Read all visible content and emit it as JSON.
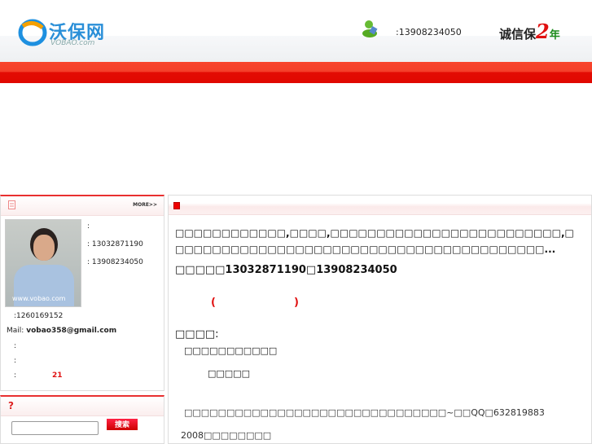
{
  "header": {
    "logo_cn": "沃保网",
    "logo_en": "VOBAO.com",
    "phone": ":13908234050",
    "badge_prefix": "诚信保",
    "badge_num": "2",
    "badge_suffix": "年"
  },
  "profile": {
    "more": "MORE>>",
    "line1": ":",
    "mobile1": ": 13032871190",
    "mobile2": ": 13908234050",
    "qq": ":1260169152",
    "mail_label": "Mail:",
    "mail": "vobao358@gmail.com",
    "line_a": ":",
    "line_b": ":",
    "line_c": ":",
    "line_c_value": "21",
    "photo_watermark": "www.vobao.com"
  },
  "search": {
    "input_value": "",
    "button": "搜索"
  },
  "main": {
    "para1": "□□□□□□□□□□□□,□□□□,□□□□□□□□□□□□□□□□□□□□□□□□□,□□□□□□□□□□□□□□□□□□□□□□□□□□□□□□□□□□□□□□□□□...",
    "contact": "□□□□□13032871190□13908234050",
    "paren_open": "(",
    "paren_close": ")",
    "section": "□□□□:",
    "item1": "□□□□□□□□□□□",
    "item2": "□□□□□",
    "item3": "□□□□□□□□□□□□□□□□□□□□□□□□□□□□□□□~□□QQ□632819883",
    "item4": "2008□□□□□□□□"
  }
}
